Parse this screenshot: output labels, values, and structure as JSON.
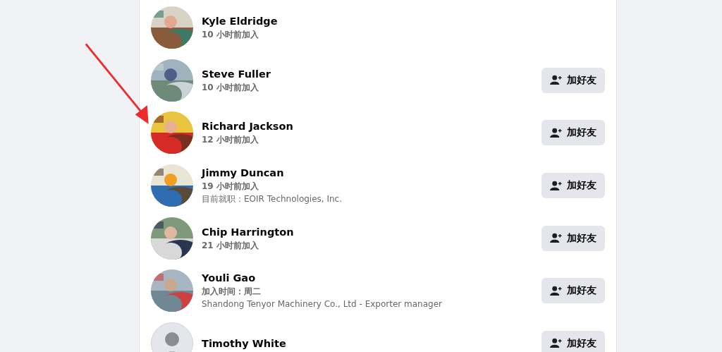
{
  "people": [
    {
      "name": "Kyle Eldridge",
      "joined": "10 小时前加入"
    },
    {
      "name": "Steve Fuller",
      "joined": "10 小时前加入",
      "button": "加好友"
    },
    {
      "name": "Richard Jackson",
      "joined": "12 小时前加入",
      "button": "加好友"
    },
    {
      "name": "Jimmy Duncan",
      "joined": "19 小时前加入",
      "detail": "目前就职：EOIR Technologies, Inc.",
      "button": "加好友"
    },
    {
      "name": "Chip Harrington",
      "joined": "21 小时前加入",
      "button": "加好友"
    },
    {
      "name": "Youli Gao",
      "joined": "加入时间：周二",
      "detail": "Shandong Tenyor Machinery Co., Ltd - Exporter manager",
      "button": "加好友"
    },
    {
      "name": "Timothy White",
      "avatar": {
        "kind": "default"
      },
      "button": "加好友"
    }
  ]
}
